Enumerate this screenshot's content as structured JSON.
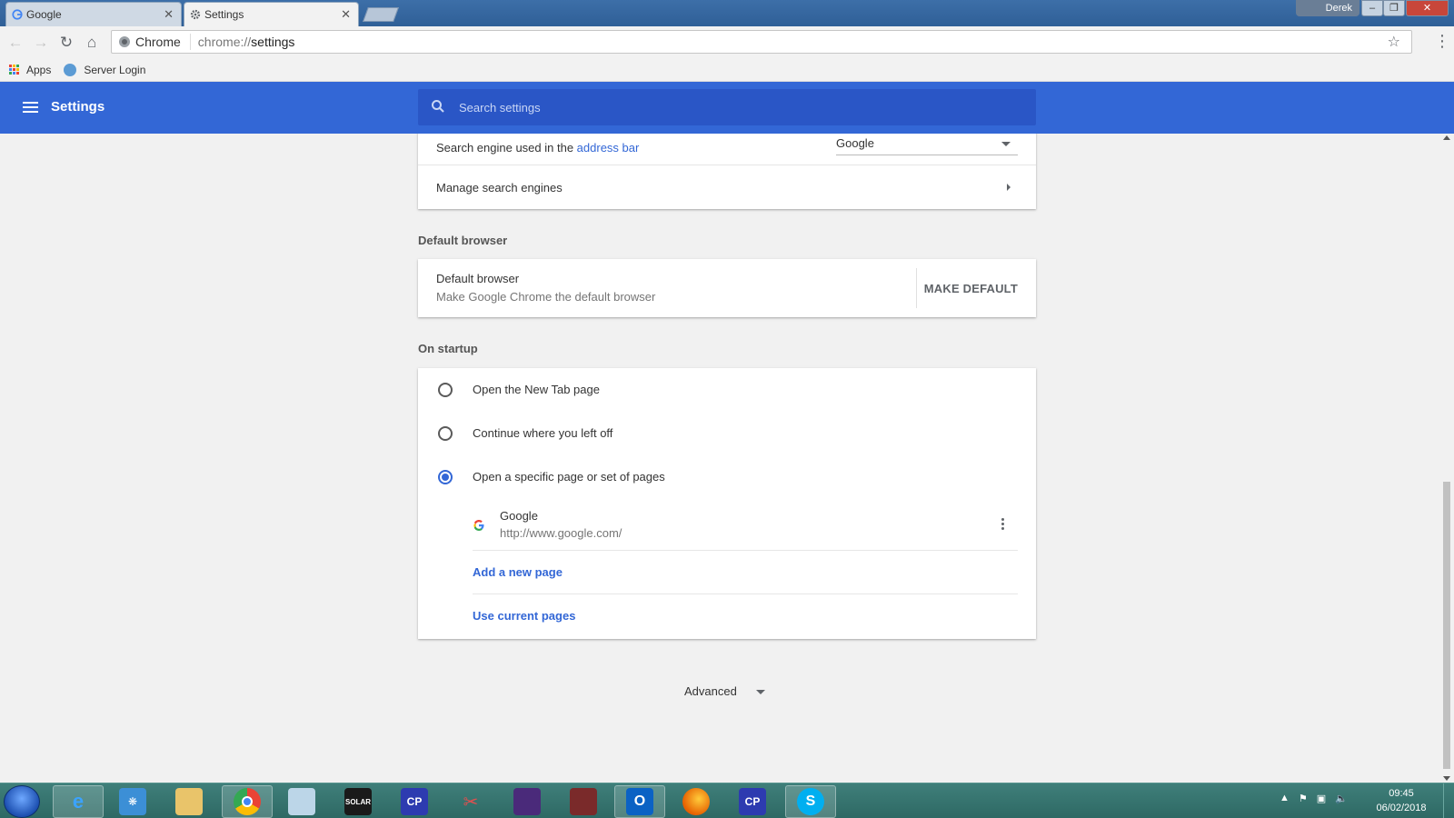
{
  "browser": {
    "tabs": [
      {
        "title": "Google",
        "active": false
      },
      {
        "title": "Settings",
        "active": true
      }
    ],
    "window_user": "Derek",
    "omnibox": {
      "site_label": "Chrome",
      "url_prefix": "chrome://",
      "url_path": "settings"
    },
    "bookmarks": [
      {
        "label": "Apps",
        "icon": "apps-grid-icon"
      },
      {
        "label": "Server Login",
        "icon": "server-login-icon"
      }
    ]
  },
  "settings": {
    "title": "Settings",
    "search_placeholder": "Search settings",
    "search_engine": {
      "label_prefix": "Search engine used in the ",
      "label_link": "address bar",
      "selected_value": "Google",
      "manage_label": "Manage search engines"
    },
    "default_browser": {
      "section_title": "Default browser",
      "row_title": "Default browser",
      "row_subtitle": "Make Google Chrome the default browser",
      "button_label": "MAKE DEFAULT"
    },
    "on_startup": {
      "section_title": "On startup",
      "options": [
        {
          "label": "Open the New Tab page",
          "selected": false
        },
        {
          "label": "Continue where you left off",
          "selected": false
        },
        {
          "label": "Open a specific page or set of pages",
          "selected": true
        }
      ],
      "pages": [
        {
          "title": "Google",
          "url": "http://www.google.com/"
        }
      ],
      "add_page_label": "Add a new page",
      "use_current_label": "Use current pages"
    },
    "advanced_label": "Advanced"
  },
  "taskbar": {
    "apps": [
      "internet-explorer-icon",
      "tree-app-icon",
      "file-explorer-icon",
      "chrome-icon",
      "notepad-icon",
      "solar-icon",
      "cp-icon",
      "scissors-icon",
      "video-editor-icon",
      "film-icon",
      "outlook-icon",
      "firefox-icon",
      "cp-icon",
      "skype-icon"
    ],
    "solar_label": "SOLAR",
    "cp_label": "CP",
    "time": "09:45",
    "date": "06/02/2018"
  },
  "colors": {
    "accent": "#3367d6",
    "header_bg": "#3367d6",
    "search_bg": "#2a56c6",
    "page_bg": "#f1f1f1"
  }
}
